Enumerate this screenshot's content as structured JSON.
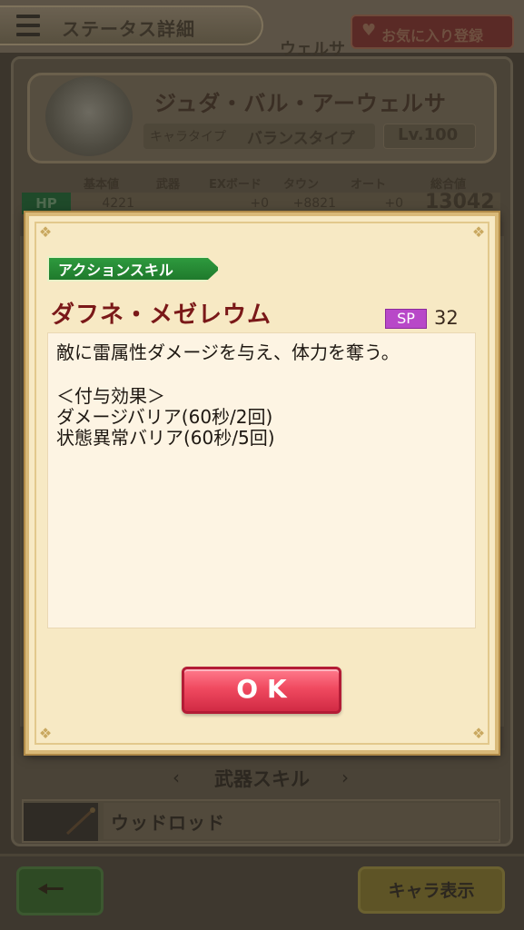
{
  "header": {
    "title": "ステータス詳細",
    "favorite_label": "お気に入り登録",
    "behind_tab_text": "ウェルサ"
  },
  "character": {
    "name": "ジュダ・バル・アーウェルサ",
    "type_label": "キャラタイプ",
    "type_value": "バランスタイプ",
    "level": "Lv.100"
  },
  "stats": {
    "headers": [
      "基本値",
      "武器",
      "EXボード",
      "タウン",
      "オート",
      "総合値"
    ],
    "hp": {
      "label": "HP",
      "base": "4221",
      "weapon": "",
      "ex_board": "+0",
      "town": "+8821",
      "auto": "+0",
      "total": "13042"
    }
  },
  "weapon_skill": {
    "section_title": "武器スキル",
    "weapon_name": "ウッドロッド"
  },
  "bottom_bar": {
    "back_icon": "left-arrow-icon",
    "chara_display_label": "キャラ表示"
  },
  "dialog": {
    "tag_label": "アクションスキル",
    "skill_name": "ダフネ・メゼレウム",
    "sp_label": "SP",
    "sp_value": "32",
    "description_lines": [
      "敵に雷属性ダメージを与え、体力を奪う。",
      "",
      "＜付与効果＞",
      "ダメージバリア(60秒/2回)",
      "状態異常バリア(60秒/5回)"
    ],
    "ok_label": "OK"
  },
  "colors": {
    "skill_tag": "#1f7a2c",
    "skill_name": "#7a1818",
    "sp_badge": "#b848c8",
    "ok_button": "#f04a60",
    "dialog_bg": "#f7e9c4"
  }
}
